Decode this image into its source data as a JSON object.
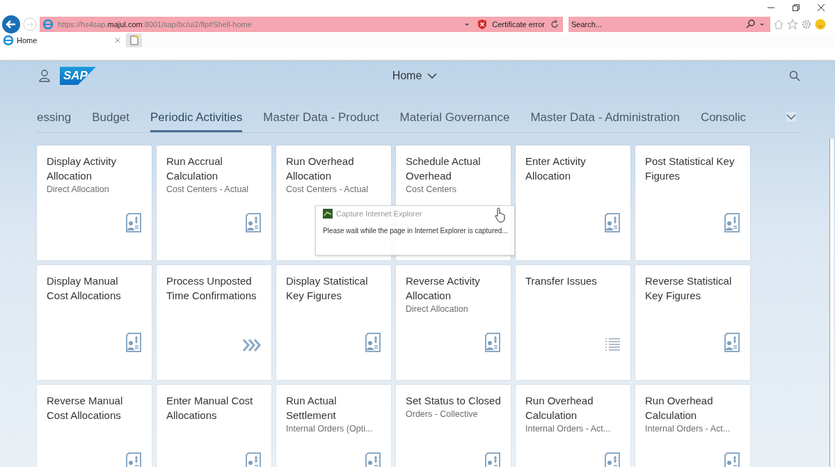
{
  "browser": {
    "address": {
      "prefix": "https://hs4sap.",
      "host": "majul.com",
      "suffix": ":8001/sap/bc/ui2/flp#Shell-home"
    },
    "certificate": "Certificate error",
    "search": {
      "placeholder": "Search..."
    },
    "tabs": [
      {
        "label": "Home",
        "selected": true
      }
    ]
  },
  "shell": {
    "title": "Home",
    "logo": "SAP"
  },
  "groups": [
    {
      "label": "essing",
      "selected": false
    },
    {
      "label": "Budget",
      "selected": false
    },
    {
      "label": "Periodic Activities",
      "selected": true
    },
    {
      "label": "Master Data - Product",
      "selected": false
    },
    {
      "label": "Material Governance",
      "selected": false
    },
    {
      "label": "Master Data - Administration",
      "selected": false
    },
    {
      "label": "Consolic",
      "selected": false
    }
  ],
  "tiles": [
    {
      "title": "Display Activity Allocation",
      "subtitle": "Direct Allocation",
      "kind": "document"
    },
    {
      "title": "Run Accrual Calculation",
      "subtitle": "Cost Centers - Actual",
      "kind": "document"
    },
    {
      "title": "Run Overhead Allocation",
      "subtitle": "Cost Centers - Actual",
      "kind": "covered"
    },
    {
      "title": "Schedule Actual Overhead",
      "subtitle": "Cost Centers",
      "kind": "covered"
    },
    {
      "title": "Enter Activity Allocation",
      "kind": "document"
    },
    {
      "title": "Post Statistical Key Figures",
      "kind": "document"
    },
    {
      "title": "Display Manual Cost Allocations",
      "kind": "document"
    },
    {
      "title": "Process Unposted Time Confirmations",
      "kind": "chevrons"
    },
    {
      "title": "Display Statistical Key Figures",
      "kind": "document"
    },
    {
      "title": "Reverse Activity Allocation",
      "subtitle": "Direct Allocation",
      "kind": "document"
    },
    {
      "title": "Transfer Issues",
      "kind": "list"
    },
    {
      "title": "Reverse Statistical Key Figures",
      "kind": "document"
    },
    {
      "title": "Reverse Manual Cost Allocations",
      "kind": "document"
    },
    {
      "title": "Enter Manual Cost Allocations",
      "kind": "document"
    },
    {
      "title": "Run Actual Settlement",
      "subtitle": "Internal Orders (Opti...",
      "kind": "document"
    },
    {
      "title": "Set Status to Closed",
      "subtitle": "Orders - Collective",
      "kind": "document"
    },
    {
      "title": "Run Overhead Calculation",
      "subtitle": "Internal Orders - Act...",
      "kind": "document"
    },
    {
      "title": "Run Overhead Calculation",
      "subtitle": "Internal Orders - Act...",
      "kind": "document"
    }
  ],
  "popup": {
    "title": "Capture Internet Explorer",
    "message": "Please wait while the page in Internet Explorer is captured..."
  }
}
